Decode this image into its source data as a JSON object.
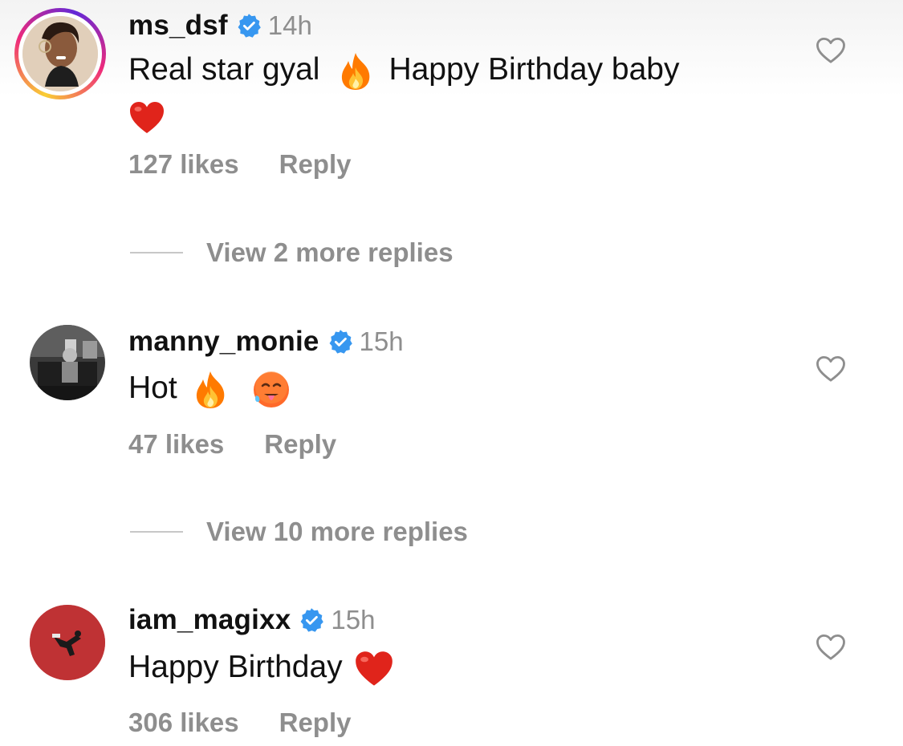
{
  "comments": [
    {
      "username": "ms_dsf",
      "time": "14h",
      "text_parts": [
        "Real star gyal",
        "Happy Birthday baby"
      ],
      "emojis": [
        "fire-emoji",
        "red-heart-emoji"
      ],
      "likes": "127 likes",
      "reply": "Reply",
      "view_more": "View 2 more replies",
      "has_story_ring": true
    },
    {
      "username": "manny_monie",
      "time": "15h",
      "text_parts": [
        "Hot"
      ],
      "emojis": [
        "fire-emoji",
        "hot-face-emoji"
      ],
      "likes": "47 likes",
      "reply": "Reply",
      "view_more": "View 10 more replies",
      "has_story_ring": false
    },
    {
      "username": "iam_magixx",
      "time": "15h",
      "text_parts": [
        "Happy Birthday"
      ],
      "emojis": [
        "red-heart-emoji"
      ],
      "likes": "306 likes",
      "reply": "Reply",
      "has_story_ring": false
    }
  ],
  "colors": {
    "verified_blue": "#3797f0",
    "secondary_text": "#8e8e8e",
    "heart_red": "#e0241b",
    "fire_orange": "#ff7a00"
  },
  "icons": {
    "verified": "verified-badge-icon",
    "like": "heart-outline-icon"
  }
}
